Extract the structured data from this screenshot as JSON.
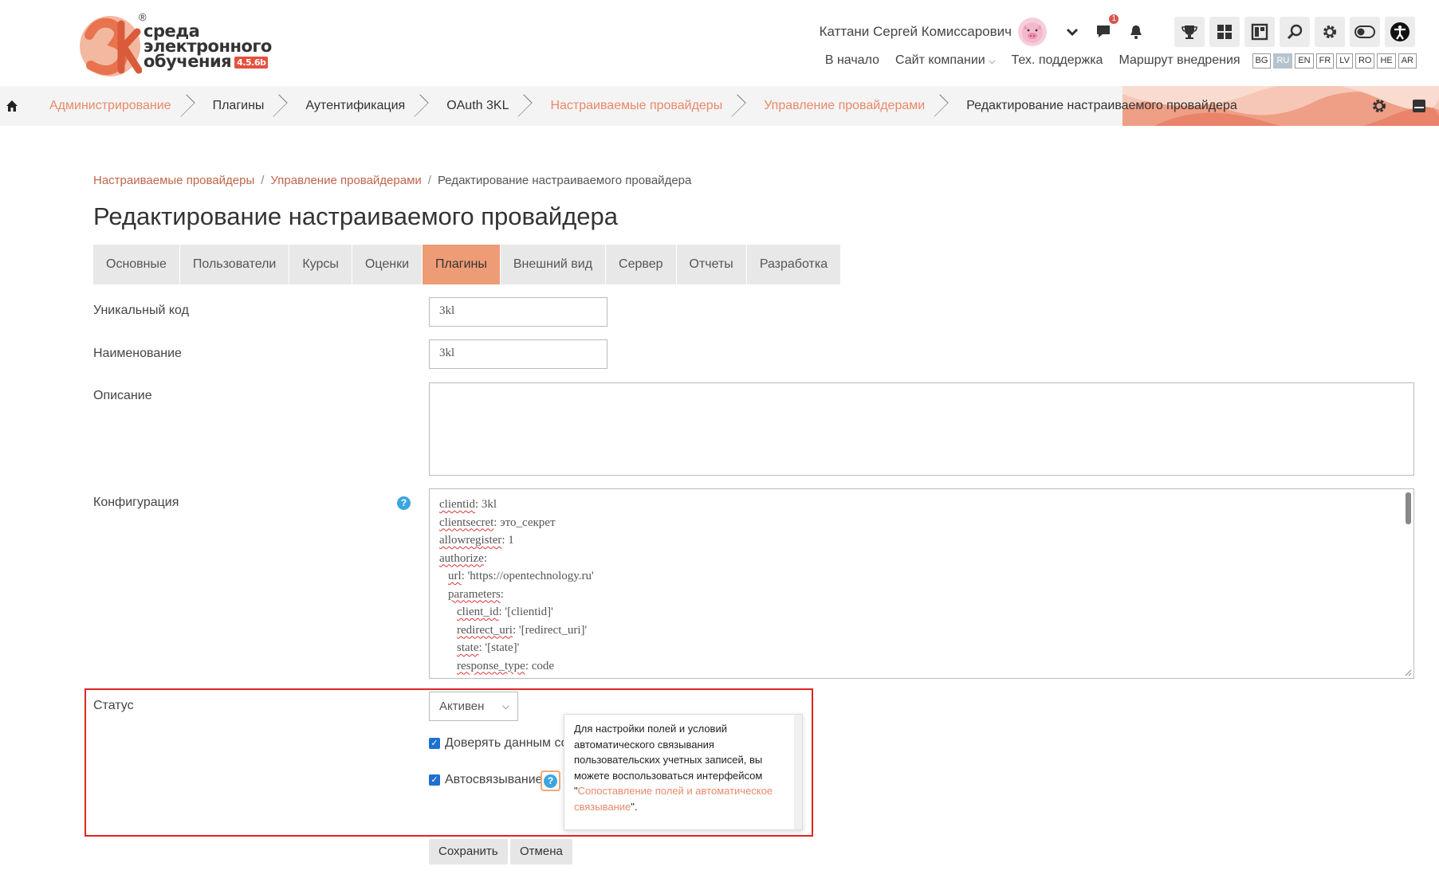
{
  "logo": {
    "line1": "среда",
    "line2": "электронного",
    "line3": "обучения",
    "version": "4.5.6b",
    "registered": "®"
  },
  "header": {
    "user_name": "Каттани Сергей Комиссарович",
    "messages_badge": "1",
    "nav": {
      "home": "В начало",
      "company_site": "Сайт компании",
      "support": "Тех. поддержка",
      "roadmap": "Маршрут внедрения"
    },
    "languages": [
      "BG",
      "RU",
      "EN",
      "FR",
      "LV",
      "RO",
      "HE",
      "AR"
    ],
    "active_language": "RU",
    "icons": [
      "trophy-icon",
      "dashboard-icon",
      "layout-icon",
      "search-icon",
      "gear-icon",
      "toggle-icon",
      "accessibility-icon"
    ]
  },
  "breadcrumb": [
    {
      "label": "Администрирование",
      "link": true
    },
    {
      "label": "Плагины",
      "link": false
    },
    {
      "label": "Аутентификация",
      "link": false
    },
    {
      "label": "OAuth 3KL",
      "link": false
    },
    {
      "label": "Настраиваемые провайдеры",
      "link": true
    },
    {
      "label": "Управление провайдерами",
      "link": true
    },
    {
      "label": "Редактирование настраиваемого провайдера",
      "link": false
    }
  ],
  "subcrumbs": {
    "item1": "Настраиваемые провайдеры",
    "item2": "Управление провайдерами",
    "item3": "Редактирование настраиваемого провайдера",
    "separator": "/"
  },
  "page_title": "Редактирование настраиваемого провайдера",
  "tabs": [
    "Основные",
    "Пользователи",
    "Курсы",
    "Оценки",
    "Плагины",
    "Внешний вид",
    "Сервер",
    "Отчеты",
    "Разработка"
  ],
  "active_tab": "Плагины",
  "form": {
    "code_label": "Уникальный код",
    "code_value": "3kl",
    "name_label": "Наименование",
    "name_value": "3kl",
    "description_label": "Описание",
    "description_value": "",
    "config_label": "Конфигурация",
    "config_lines": [
      {
        "key": "clientid",
        "rest": ": 3kl",
        "indent": 0
      },
      {
        "key": "clientsecret",
        "rest": ": это_секрет",
        "indent": 0
      },
      {
        "key": "allowregister",
        "rest": ": 1",
        "indent": 0
      },
      {
        "key": "authorize",
        "rest": ":",
        "indent": 0
      },
      {
        "key": "url",
        "rest": ": 'https://opentechnology.ru'",
        "indent": 1
      },
      {
        "key": "parameters",
        "rest": ":",
        "indent": 1
      },
      {
        "key": "client_id",
        "rest": ": '[clientid]'",
        "indent": 2
      },
      {
        "key": "redirect_uri",
        "rest": ": '[redirect_uri]'",
        "indent": 2
      },
      {
        "key": "state",
        "rest": ": '[state]'",
        "indent": 2
      },
      {
        "key": "response_type",
        "rest": ": code",
        "indent": 2
      }
    ],
    "status_label": "Статус",
    "status_value": "Активен",
    "trust_label": "Доверять данным со",
    "autolink_label": "Автосвязывание",
    "save_button": "Сохранить",
    "cancel_button": "Отмена"
  },
  "popover": {
    "text": "Для настройки полей и условий автоматического связывания пользовательских учетных записей, вы можете воспользоваться интерфейсом \"",
    "link": "Сопоставление полей и автоматическое связывание",
    "tail": "\"."
  },
  "colors": {
    "accent": "#ee9c76",
    "link": "#e9896a",
    "highlight": "#e02424",
    "checkbox": "#1f6fd2",
    "help": "#39a6e0"
  }
}
